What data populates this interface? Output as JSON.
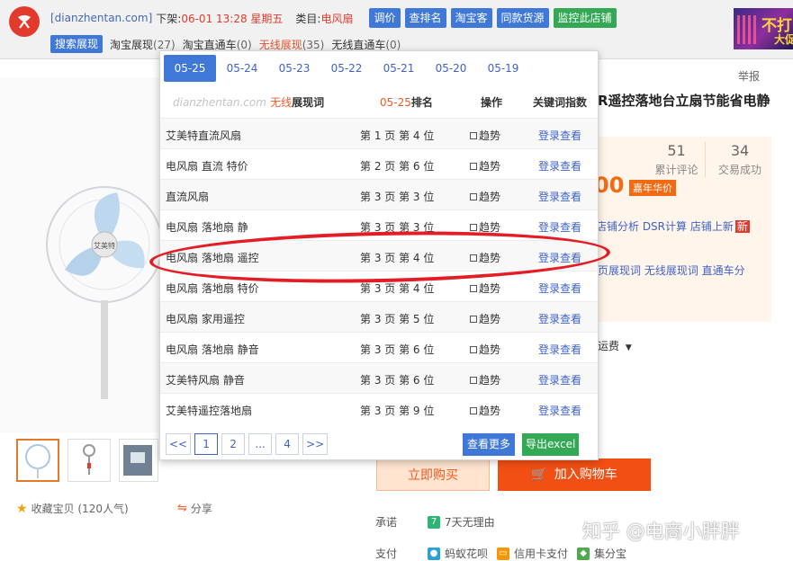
{
  "toolbar": {
    "site": "[dianzhentan.com]",
    "listed_label": "下架:",
    "listed_time": "06-01 13:28 星期五",
    "category_label": "类目:",
    "category": "电风扇",
    "buttons": [
      "调价",
      "查排名",
      "淘宝客",
      "同款货源",
      "监控此店铺"
    ],
    "filters": [
      {
        "label": "搜索展现",
        "count": ""
      },
      {
        "label": "淘宝展现",
        "count": "(27)"
      },
      {
        "label": "淘宝直通车",
        "count": "(0)"
      },
      {
        "label": "无线展现",
        "count": "(35)"
      },
      {
        "label": "无线直通车",
        "count": "(0)"
      }
    ],
    "ad_line1": "不打",
    "ad_line2": "大促"
  },
  "popup": {
    "dates": [
      "05-25",
      "05-24",
      "05-23",
      "05-22",
      "05-21",
      "05-20",
      "05-19"
    ],
    "header": {
      "site": "dianzhentan.com",
      "kw_type": "无线",
      "kw_col": "展现词",
      "date": "05-25",
      "rank_col": "排名",
      "op_col": "操作",
      "index_col": "关键词指数"
    },
    "rows": [
      {
        "keyword": "艾美特直流风扇",
        "rank": "第 1 页 第 4 位",
        "trend": "趋势",
        "login": "登录查看"
      },
      {
        "keyword": "电风扇 直流 特价",
        "rank": "第 2 页 第 6 位",
        "trend": "趋势",
        "login": "登录查看"
      },
      {
        "keyword": "直流风扇",
        "rank": "第 3 页 第 3 位",
        "trend": "趋势",
        "login": "登录查看"
      },
      {
        "keyword": "电风扇 落地扇 静",
        "rank": "第 3 页 第 3 位",
        "trend": "趋势",
        "login": "登录查看"
      },
      {
        "keyword": "电风扇 落地扇 遥控",
        "rank": "第 3 页 第 4 位",
        "trend": "趋势",
        "login": "登录查看"
      },
      {
        "keyword": "电风扇 落地扇 特价",
        "rank": "第 3 页 第 4 位",
        "trend": "趋势",
        "login": "登录查看"
      },
      {
        "keyword": "电风扇 家用遥控",
        "rank": "第 3 页 第 5 位",
        "trend": "趋势",
        "login": "登录查看"
      },
      {
        "keyword": "电风扇 落地扇 静音",
        "rank": "第 3 页 第 6 位",
        "trend": "趋势",
        "login": "登录查看"
      },
      {
        "keyword": "艾美特风扇 静音",
        "rank": "第 3 页 第 6 位",
        "trend": "趋势",
        "login": "登录查看"
      },
      {
        "keyword": "艾美特遥控落地扇",
        "rank": "第 3 页 第 9 位",
        "trend": "趋势",
        "login": "登录查看"
      }
    ],
    "pager": [
      "<<",
      "1",
      "2",
      "...",
      "4",
      ">>"
    ],
    "more_btn": "查看更多",
    "excel_btn": "导出excel"
  },
  "product": {
    "report": "举报",
    "title_fragment": "R遥控落地台立扇节能省电静",
    "reviews_count": "51",
    "reviews_label": "累计评论",
    "deals_count": "34",
    "deals_label": "交易成功",
    "price_fragment": "00",
    "year_tag": "嘉年华价",
    "tool_links": "店铺分析 DSR计算 店铺上新",
    "tool_hot": "新",
    "kw_links": "页展现词 无线展现词 直通车分",
    "shipping_fragment": "运费",
    "favorite": "收藏宝贝 (120人气)",
    "share": "分享",
    "buy_now": "立即购买",
    "add_cart": "加入购物车",
    "promise_label": "承诺",
    "promise_value": "7天无理由",
    "pay_label": "支付",
    "pay_methods": [
      "蚂蚁花呗",
      "信用卡支付",
      "集分宝"
    ],
    "watermark": "知乎 @电商小胖胖"
  },
  "colors": {
    "accent_blue": "#3f78d6",
    "accent_green": "#33a955",
    "brand_orange": "#f24f14",
    "highlight_red": "#e21d25"
  }
}
